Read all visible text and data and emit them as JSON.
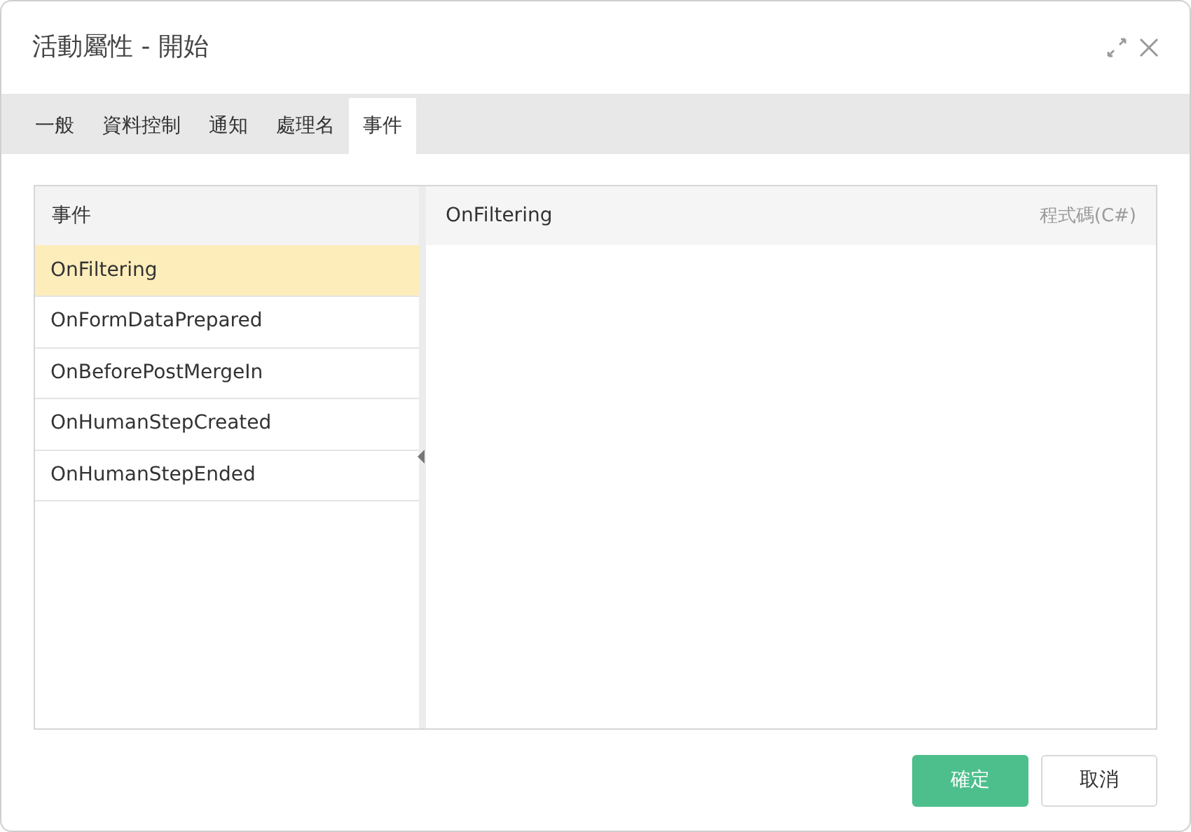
{
  "window": {
    "title": "活動屬性 - 開始"
  },
  "tabs": [
    {
      "label": "一般",
      "selected": false
    },
    {
      "label": "資料控制",
      "selected": false
    },
    {
      "label": "通知",
      "selected": false
    },
    {
      "label": "處理名",
      "selected": false
    },
    {
      "label": "事件",
      "selected": true
    }
  ],
  "events": {
    "header": "事件",
    "items": [
      {
        "label": "OnFiltering",
        "selected": true
      },
      {
        "label": "OnFormDataPrepared",
        "selected": false
      },
      {
        "label": "OnBeforePostMergeIn",
        "selected": false
      },
      {
        "label": "OnHumanStepCreated",
        "selected": false
      },
      {
        "label": "OnHumanStepEnded",
        "selected": false
      }
    ]
  },
  "editor": {
    "title": "OnFiltering",
    "language": "程式碼(C#)"
  },
  "buttons": [
    {
      "label": "確定",
      "kind": "primary"
    },
    {
      "label": "取消",
      "kind": "secondary"
    }
  ]
}
